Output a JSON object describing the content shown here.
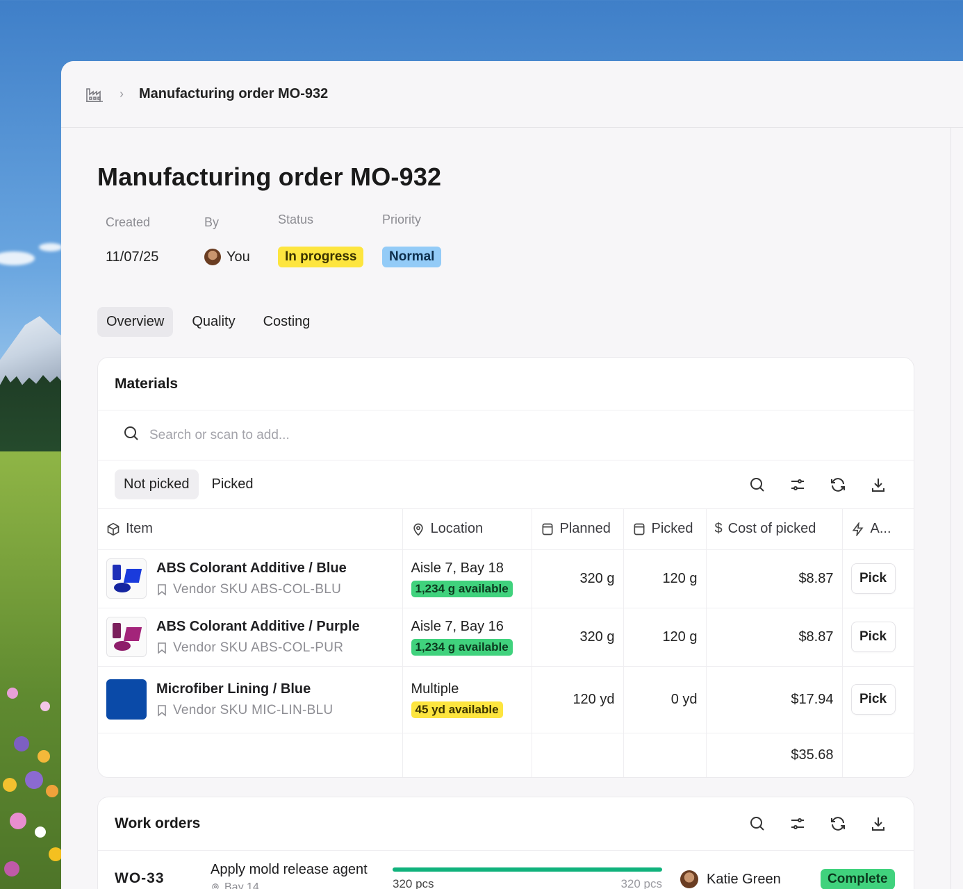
{
  "breadcrumb": {
    "current": "Manufacturing order MO-932"
  },
  "page_title": "Manufacturing order MO-932",
  "meta": {
    "created_label": "Created",
    "created_value": "11/07/25",
    "by_label": "By",
    "by_value": "You",
    "status_label": "Status",
    "status_value": "In progress",
    "priority_label": "Priority",
    "priority_value": "Normal"
  },
  "tabs": [
    "Overview",
    "Quality",
    "Costing"
  ],
  "materials": {
    "title": "Materials",
    "search_placeholder": "Search or scan to add...",
    "filters": [
      "Not picked",
      "Picked"
    ],
    "columns": [
      "Item",
      "Location",
      "Planned",
      "Picked",
      "Cost of picked",
      "A..."
    ],
    "rows": [
      {
        "name": "ABS Colorant Additive / Blue",
        "sku": "Vendor SKU ABS-COL-BLU",
        "location": "Aisle 7, Bay 18",
        "available": "1,234 g available",
        "planned": "320 g",
        "picked": "120 g",
        "cost": "$8.87",
        "action": "Pick"
      },
      {
        "name": "ABS Colorant Additive / Purple",
        "sku": "Vendor SKU ABS-COL-PUR",
        "location": "Aisle 7, Bay 16",
        "available": "1,234 g available",
        "planned": "320 g",
        "picked": "120 g",
        "cost": "$8.87",
        "action": "Pick"
      },
      {
        "name": "Microfiber Lining / Blue",
        "sku": "Vendor SKU MIC-LIN-BLU",
        "location": "Multiple",
        "available": "45 yd available",
        "planned": "120 yd",
        "picked": "0 yd",
        "cost": "$17.94",
        "action": "Pick"
      }
    ],
    "total_cost": "$35.68"
  },
  "work_orders": {
    "title": "Work orders",
    "rows": [
      {
        "id": "WO-33",
        "task": "Apply mold release agent",
        "location": "Bay 14",
        "done": "320 pcs",
        "total": "320 pcs",
        "progress": 1.0,
        "assignee": "Katie Green",
        "status": "Complete"
      }
    ]
  },
  "colors": {
    "status_in_progress": "#fde53f",
    "priority_normal": "#93cbf7",
    "available_green": "#40d27d",
    "available_yellow": "#fde53f",
    "progress_fill": "#10b27c",
    "swatch_blue": "#0a4aa8"
  }
}
